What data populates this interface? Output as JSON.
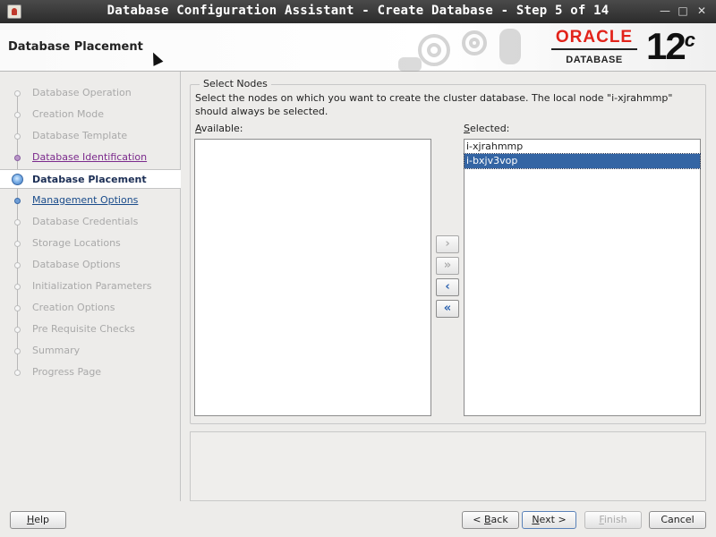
{
  "window": {
    "title": "Database Configuration Assistant - Create Database - Step 5 of 14",
    "minimize_glyph": "—",
    "maximize_glyph": "□",
    "close_glyph": "✕"
  },
  "header": {
    "page_title": "Database Placement",
    "logo_text": "ORACLE",
    "logo_sub": "DATABASE",
    "version_num": "12",
    "version_sup": "c",
    "brand_color": "#e2231a"
  },
  "nav": {
    "items": [
      {
        "label": "Database Operation",
        "state": "disabled"
      },
      {
        "label": "Creation Mode",
        "state": "disabled"
      },
      {
        "label": "Database Template",
        "state": "disabled"
      },
      {
        "label": "Database Identification",
        "state": "visited"
      },
      {
        "label": "Database Placement",
        "state": "active"
      },
      {
        "label": "Management Options",
        "state": "link"
      },
      {
        "label": "Database Credentials",
        "state": "disabled"
      },
      {
        "label": "Storage Locations",
        "state": "disabled"
      },
      {
        "label": "Database Options",
        "state": "disabled"
      },
      {
        "label": "Initialization Parameters",
        "state": "disabled"
      },
      {
        "label": "Creation Options",
        "state": "disabled"
      },
      {
        "label": "Pre Requisite Checks",
        "state": "disabled"
      },
      {
        "label": "Summary",
        "state": "disabled"
      },
      {
        "label": "Progress Page",
        "state": "disabled"
      }
    ]
  },
  "main": {
    "group_title": "Select Nodes",
    "description": "Select the nodes on which you want to create the cluster database. The local node \"i-xjrahmmp\" should always be selected.",
    "available_label": "Available:",
    "available_items": [],
    "selected_label": "Selected:",
    "selected_items": [
      "i-xjrahmmp",
      "i-bxjv3vop"
    ],
    "selected_index": 1,
    "move_buttons": [
      {
        "name": "move-right-button",
        "glyph": "›",
        "enabled": false
      },
      {
        "name": "move-all-right-button",
        "glyph": "»",
        "enabled": false
      },
      {
        "name": "move-left-button",
        "glyph": "‹",
        "enabled": true
      },
      {
        "name": "move-all-left-button",
        "glyph": "«",
        "enabled": true
      }
    ]
  },
  "buttons": {
    "help": "Help",
    "back": "< Back",
    "next": "Next >",
    "finish": "Finish",
    "cancel": "Cancel"
  }
}
